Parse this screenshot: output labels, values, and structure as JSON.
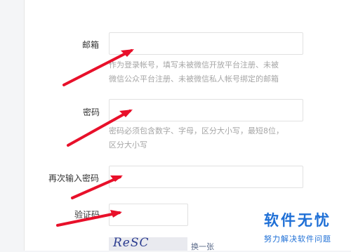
{
  "form": {
    "email_label": "邮箱",
    "email_hint_line1": "作为登录帐号，填写未被微信开放平台注册、未被",
    "email_hint_line2": "微信公众平台注册、未被微信私人帐号绑定的邮箱",
    "password_label": "密码",
    "password_hint_line1": "密码必须包含数字、字母，区分大小写，最短8位，",
    "password_hint_line2": "区分大小写",
    "confirm_label": "再次输入密码",
    "captcha_label": "验证码",
    "captcha_image_text": "ReSC",
    "captcha_swap_link": "换一张"
  },
  "watermark": {
    "title": "软件无忧",
    "subtitle": "努力解决软件问题"
  },
  "colors": {
    "arrow": "#e8102a",
    "watermark": "#1e6fd6",
    "hint": "#a6a6a6"
  }
}
